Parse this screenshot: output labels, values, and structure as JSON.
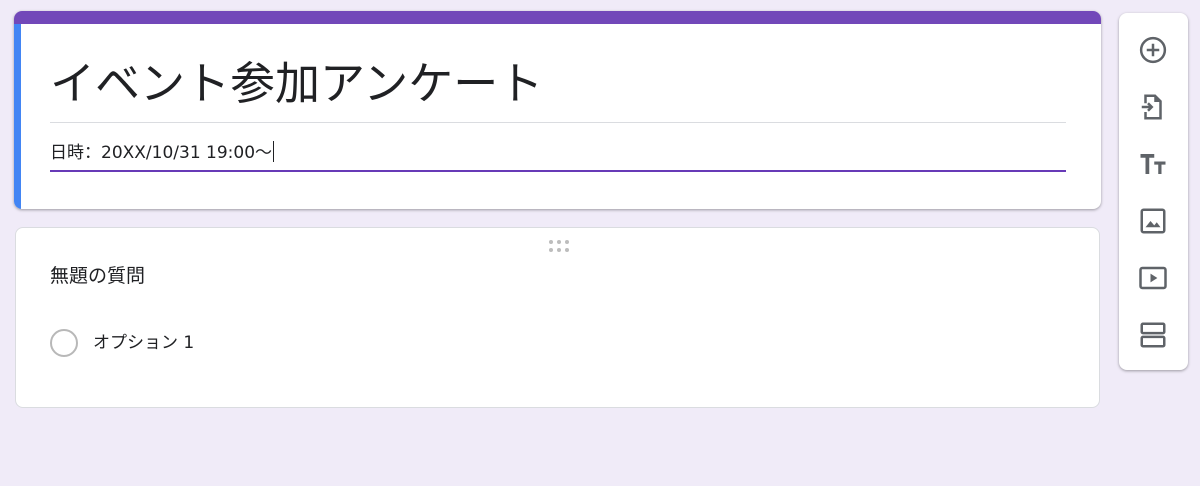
{
  "form": {
    "title": "イベント参加アンケート",
    "description": "日時：20XX/10/31  19:00〜"
  },
  "question": {
    "title": "無題の質問",
    "option_1": "オプション 1"
  },
  "toolbar": {
    "icons": [
      "add-question-icon",
      "import-questions-icon",
      "add-title-icon",
      "add-image-icon",
      "add-video-icon",
      "add-section-icon"
    ]
  },
  "colors": {
    "accent": "#673ab7",
    "header_bar": "#7248b9",
    "active_card_bar": "#4285f4",
    "background": "#f0ebf8",
    "icon": "#5f6368"
  }
}
